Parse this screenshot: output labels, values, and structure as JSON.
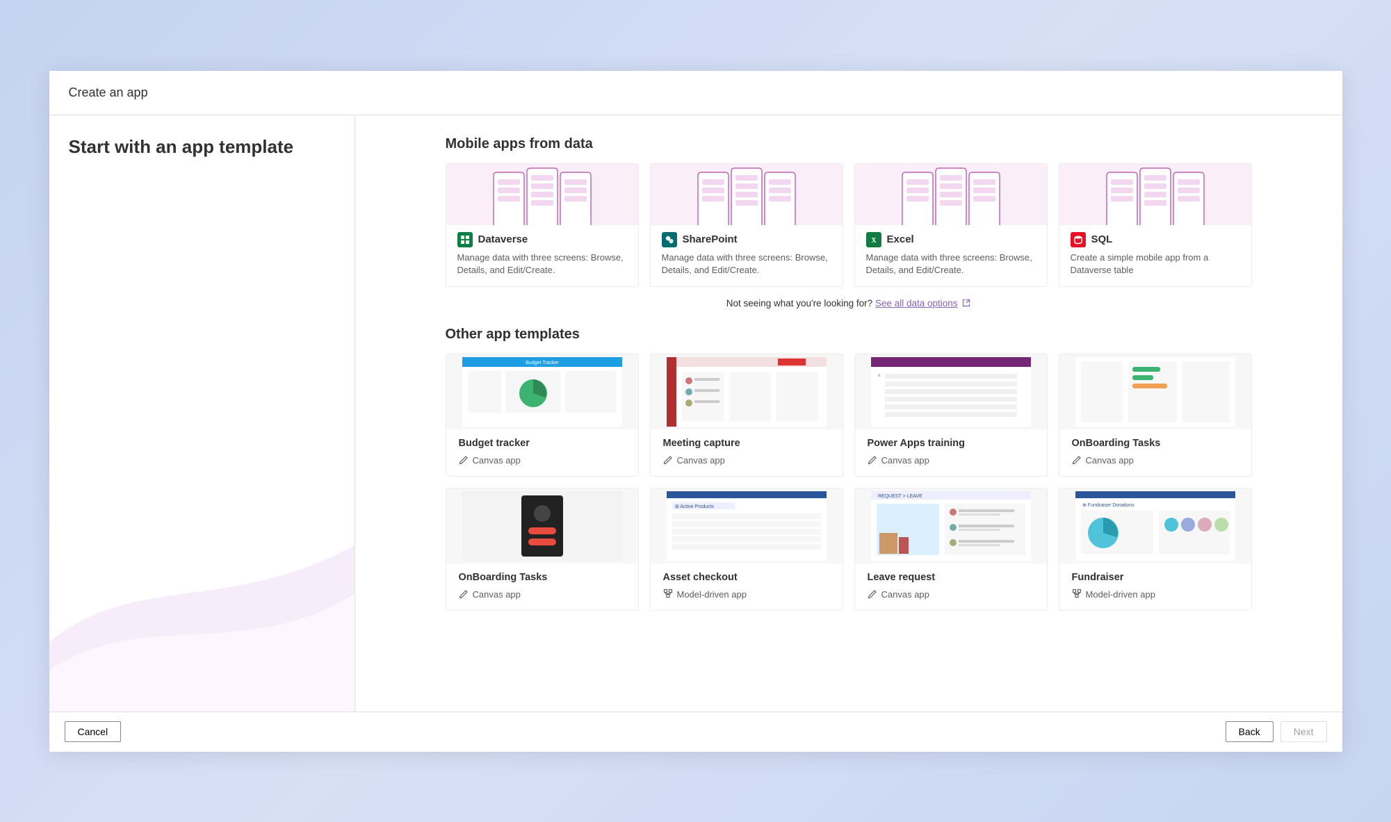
{
  "titlebar": {
    "title": "Create an app"
  },
  "sidebar": {
    "heading": "Start with an app template"
  },
  "sections": {
    "data_title": "Mobile apps from data",
    "other_title": "Other app templates",
    "help_prefix": "Not seeing what you're looking for? ",
    "help_link": "See all data options"
  },
  "data_cards": [
    {
      "label": "Dataverse",
      "icon_bg": "#0b8043",
      "icon": "grid",
      "desc": "Manage data with three screens: Browse, Details, and Edit/Create."
    },
    {
      "label": "SharePoint",
      "icon_bg": "#036c70",
      "icon": "sp",
      "desc": "Manage data with three screens: Browse, Details, and Edit/Create."
    },
    {
      "label": "Excel",
      "icon_bg": "#107c41",
      "icon": "xl",
      "desc": "Manage data with three screens: Browse, Details, and Edit/Create."
    },
    {
      "label": "SQL",
      "icon_bg": "#e81123",
      "icon": "db",
      "desc": "Create a simple mobile app from a Dataverse table"
    }
  ],
  "templates": [
    {
      "label": "Budget tracker",
      "type": "Canvas app",
      "thumb": "budget"
    },
    {
      "label": "Meeting capture",
      "type": "Canvas app",
      "thumb": "meeting"
    },
    {
      "label": "Power Apps training",
      "type": "Canvas app",
      "thumb": "training"
    },
    {
      "label": "OnBoarding Tasks",
      "type": "Canvas app",
      "thumb": "onboard1"
    },
    {
      "label": "OnBoarding Tasks",
      "type": "Canvas app",
      "thumb": "onboard2"
    },
    {
      "label": "Asset checkout",
      "type": "Model-driven app",
      "thumb": "asset"
    },
    {
      "label": "Leave request",
      "type": "Canvas app",
      "thumb": "leave"
    },
    {
      "label": "Fundraiser",
      "type": "Model-driven app",
      "thumb": "fundraiser"
    }
  ],
  "footer": {
    "cancel": "Cancel",
    "back": "Back",
    "next": "Next"
  },
  "colors": {
    "accent_purple": "#8764b8",
    "thumb_pink": "#faeff9",
    "phone_stroke": "#b146a7"
  }
}
